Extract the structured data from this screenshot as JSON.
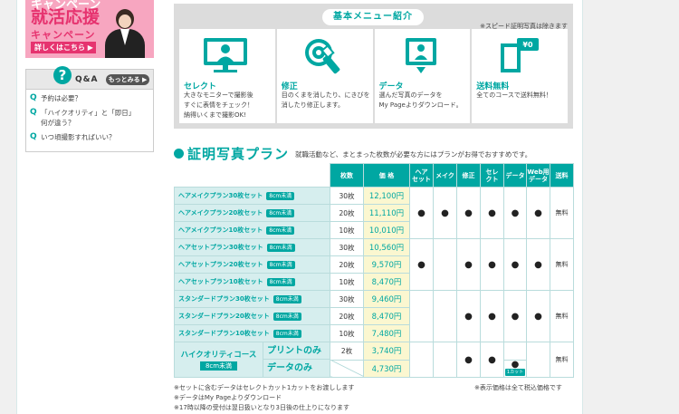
{
  "banner": {
    "top_text": "キャンペーン",
    "title": "就活応援",
    "subtitle": "キャンペーン",
    "button": "詳しくはこちら ▶"
  },
  "qa": {
    "title": "Q&A",
    "more": "もっとみる ▶",
    "items": [
      "予約は必要？",
      "「ハイクオリティ」と「即日」\n何が違う？",
      "いつ頃撮影すればいい？"
    ]
  },
  "menu": {
    "title": "基本メニュー紹介",
    "note": "※スピード証明写真は除きます",
    "cards": [
      {
        "icon": "monitor-person-icon",
        "title": "セレクト",
        "desc": "大きなモニターで撮影後\nすぐに表情をチェック！\n納得いくまで撮影OK!"
      },
      {
        "icon": "retouch-icon",
        "title": "修正",
        "desc": "目のくまを消したり、にきびを\n消したり修正します。"
      },
      {
        "icon": "download-icon",
        "title": "データ",
        "desc": "選んだ写真のデータを\nMy Pageよりダウンロード。"
      },
      {
        "icon": "free-shipping-icon",
        "title": "送料無料",
        "desc": "全てのコースで送料無料！"
      }
    ]
  },
  "plan": {
    "title": "証明写真プラン",
    "desc": "就職活動など、まとまった枚数が必要な方にはプランがお得でおすすめです。",
    "headers": [
      "枚数",
      "価 格",
      "ヘア\nセット",
      "メイク",
      "修正",
      "セレ\nクト",
      "データ",
      "Web用\nデータ",
      "送料"
    ],
    "tag": "8cm未満",
    "dot": "●",
    "free": "無料",
    "rows": [
      {
        "name": "ヘアメイクプラン30枚セット",
        "count": "30枚",
        "price": "12,100円"
      },
      {
        "name": "ヘアメイクプラン20枚セット",
        "count": "20枚",
        "price": "11,110円"
      },
      {
        "name": "ヘアメイクプラン10枚セット",
        "count": "10枚",
        "price": "10,010円"
      },
      {
        "name": "ヘアセットプラン30枚セット",
        "count": "30枚",
        "price": "10,560円"
      },
      {
        "name": "ヘアセットプラン20枚セット",
        "count": "20枚",
        "price": "9,570円"
      },
      {
        "name": "ヘアセットプラン10枚セット",
        "count": "10枚",
        "price": "8,470円"
      },
      {
        "name": "スタンダードプラン30枚セット",
        "count": "30枚",
        "price": "9,460円"
      },
      {
        "name": "スタンダードプラン20枚セット",
        "count": "20枚",
        "price": "8,470円"
      },
      {
        "name": "スタンダードプラン10枚セット",
        "count": "10枚",
        "price": "7,480円"
      }
    ],
    "hq": {
      "name": "ハイクオリティコース",
      "tag": "8cm未満",
      "print_label": "プリントのみ",
      "print_count": "2枚",
      "print_price": "3,740円",
      "data_label": "データのみ",
      "data_price": "4,730円",
      "cut": "1カット"
    }
  },
  "notes": [
    "※セットに含むデータはセレクトカット1カットをお渡しします",
    "※データはMy Pageよりダウンロード",
    "※17時以降の受付は翌日扱いとなり3日後の仕上りになります"
  ],
  "note_right": "※表示価格は全て税込価格です"
}
